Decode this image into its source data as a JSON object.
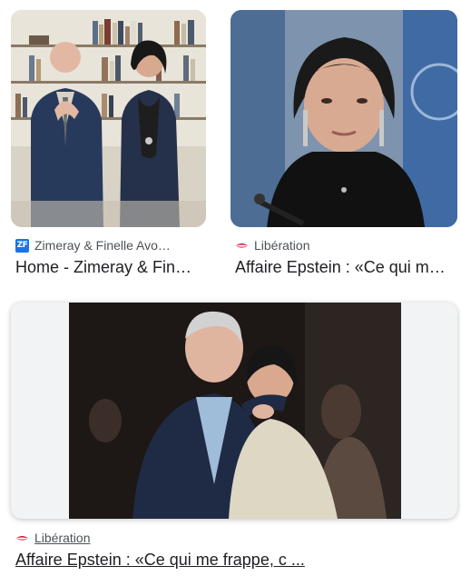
{
  "results": [
    {
      "source": "Zimeray & Finelle Avo…",
      "favicon_text": "ZF",
      "title": "Home - Zimeray & Fin…",
      "favicon": "zf-logo-icon"
    },
    {
      "source": "Libération",
      "title": "Affaire Epstein : «Ce qui m…",
      "favicon": "liberation-logo-icon"
    },
    {
      "source": "Libération",
      "title": "Affaire Epstein : «Ce qui me frappe, c ...",
      "favicon": "liberation-logo-icon"
    }
  ],
  "colors": {
    "liberation_red": "#e4002b",
    "zf_blue": "#1a73e8"
  }
}
